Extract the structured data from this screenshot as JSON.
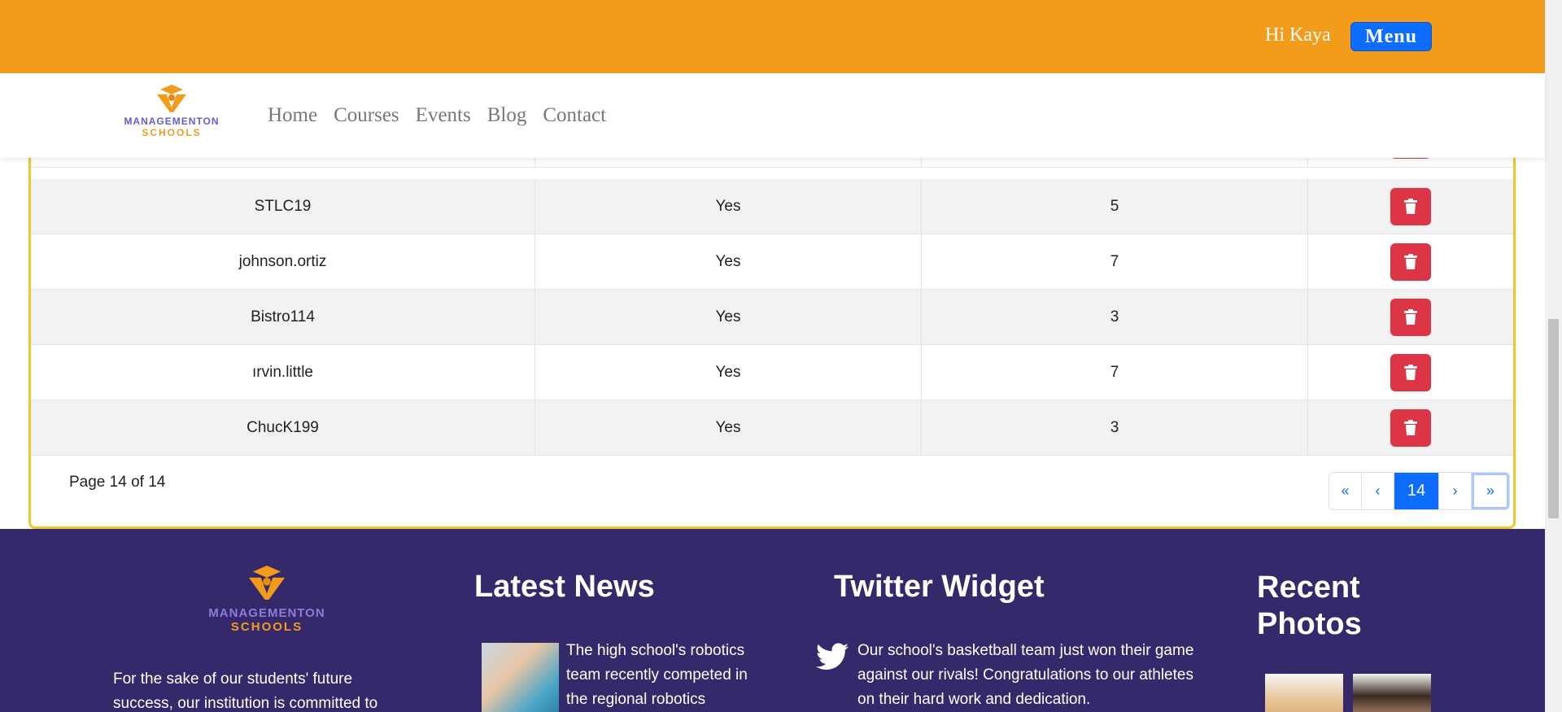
{
  "header": {
    "greeting": "Hi Kaya",
    "menu_label": "Menu",
    "accent_color": "#f39c1c"
  },
  "logo": {
    "line1": "MANAGEMENTON",
    "line2": "SCHOOLS"
  },
  "nav": {
    "items": [
      "Home",
      "Courses",
      "Events",
      "Blog",
      "Contact"
    ]
  },
  "table": {
    "rows": [
      {
        "username": "STLC19",
        "active": "Yes",
        "count": "5"
      },
      {
        "username": "johnson.ortiz",
        "active": "Yes",
        "count": "7"
      },
      {
        "username": "Bistro114",
        "active": "Yes",
        "count": "3"
      },
      {
        "username": "ırvin.little",
        "active": "Yes",
        "count": "7"
      },
      {
        "username": "ChucK199",
        "active": "Yes",
        "count": "3"
      }
    ],
    "delete_icon": "trash-icon"
  },
  "pagination": {
    "info": "Page 14 of 14",
    "first": "«",
    "prev": "‹",
    "current": "14",
    "next": "›",
    "last": "»"
  },
  "footer": {
    "logo": {
      "line1": "MANAGEMENTON",
      "line2": "SCHOOLS"
    },
    "about": "For the sake of our students' future success, our institution is committed to",
    "news_heading": "Latest News",
    "news_text": "The high school's robotics team recently competed in the regional robotics",
    "twitter_heading": "Twitter Widget",
    "twitter_text": "Our school's basketball team just won their game against our rivals! Congratulations to our athletes on their hard work and dedication.",
    "photos_heading": "Recent Photos"
  }
}
